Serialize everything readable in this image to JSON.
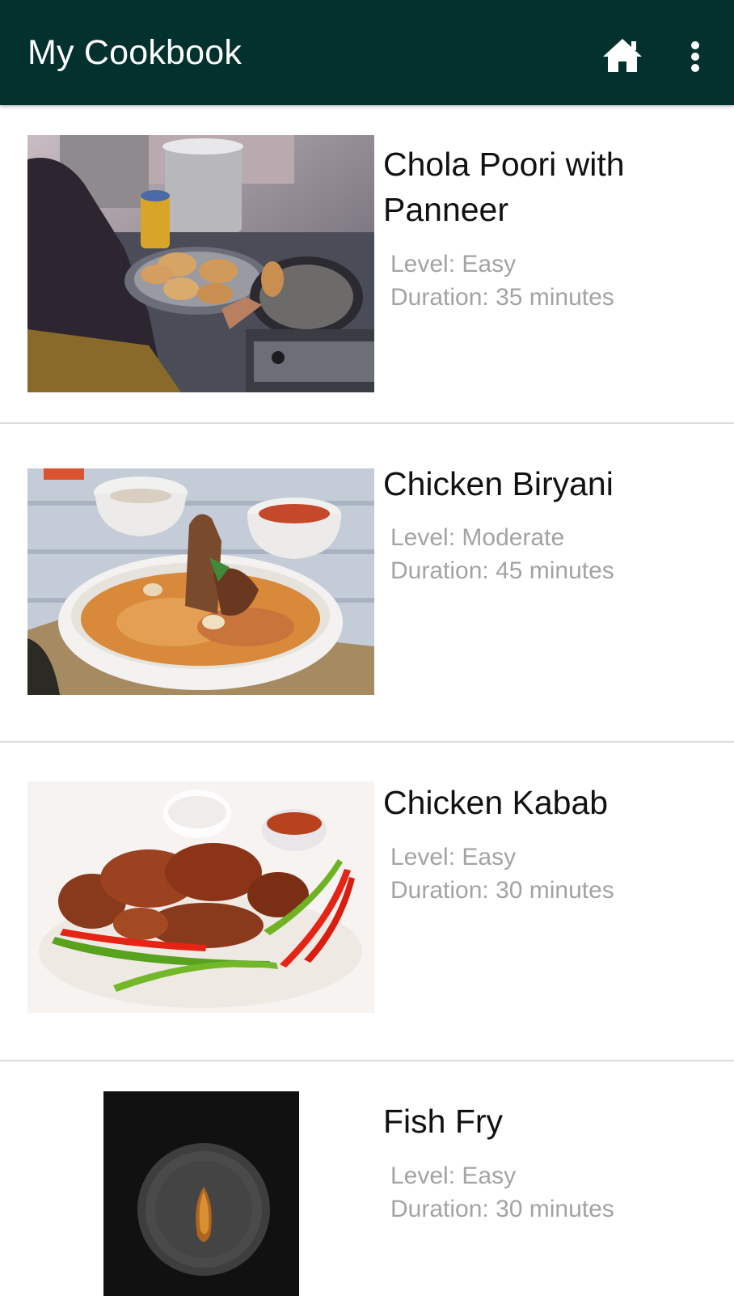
{
  "app_bar": {
    "title": "My Cookbook",
    "home_icon": "home-icon",
    "menu_icon": "more-vert-icon",
    "background": "#03312e"
  },
  "recipes": [
    {
      "name": "Chola Poori with Panneer",
      "level": "Level: Easy",
      "duration": "Duration: 35 minutes",
      "image": "chola-poori-photo"
    },
    {
      "name": "Chicken Biryani",
      "level": "Level: Moderate",
      "duration": "Duration: 45 minutes",
      "image": "chicken-biryani-photo"
    },
    {
      "name": "Chicken Kabab",
      "level": "Level: Easy",
      "duration": "Duration: 30 minutes",
      "image": "chicken-kabab-photo"
    },
    {
      "name": "Fish Fry",
      "level": "Level: Easy",
      "duration": "Duration: 30 minutes",
      "image": "fish-fry-photo"
    }
  ]
}
